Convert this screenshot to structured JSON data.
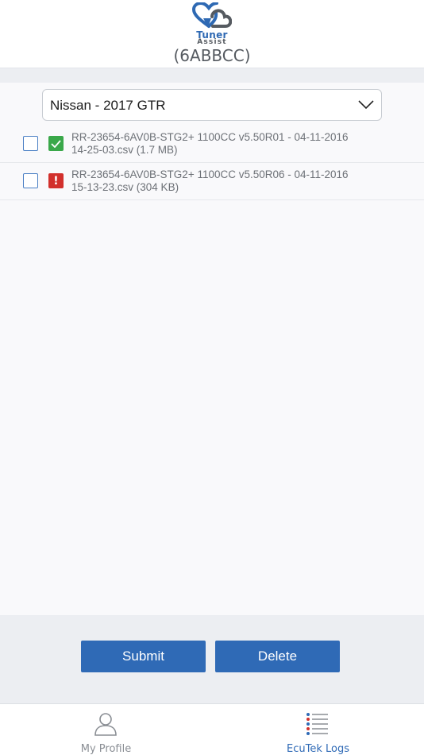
{
  "header": {
    "logo_line1": "Tuner",
    "logo_line2": "Assist",
    "device_id": "(6ABBCC)"
  },
  "vehicle_select": {
    "selected": "Nissan - 2017 GTR"
  },
  "logs": [
    {
      "line1": "RR-23654-6AV0B-STG2+ 1100CC  v5.50R01 - 04-11-2016",
      "line2": "14-25-03.csv (1.7 MB)",
      "status": "success",
      "status_icon": "check-icon",
      "checked": false
    },
    {
      "line1": "RR-23654-6AV0B-STG2+ 1100CC  v5.50R06 - 04-11-2016",
      "line2": "15-13-23.csv (304 KB)",
      "status": "error",
      "status_icon": "exclamation-icon",
      "status_glyph": "!",
      "checked": false
    }
  ],
  "actions": {
    "submit_label": "Submit",
    "delete_label": "Delete"
  },
  "tabs": [
    {
      "label": "My Profile",
      "icon": "user-icon",
      "active": false
    },
    {
      "label": "EcuTek Logs",
      "icon": "list-icon",
      "active": true
    }
  ],
  "colors": {
    "primary": "#2f6ab6",
    "success": "#3aa84a",
    "error": "#d2302c",
    "background": "#eceef2"
  }
}
